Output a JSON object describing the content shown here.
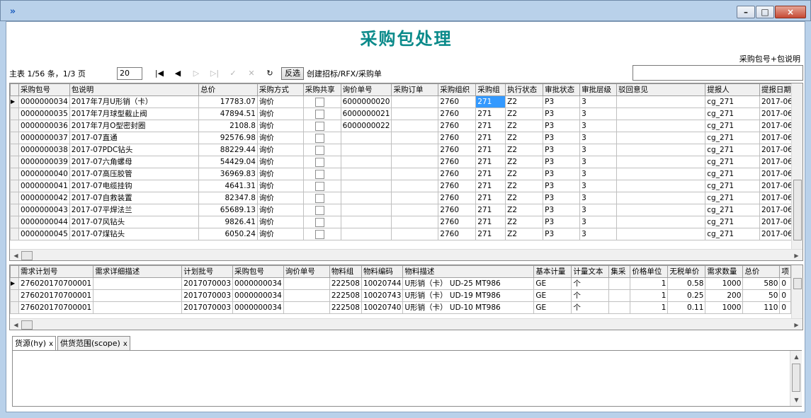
{
  "window": {
    "min_icon": "minimize-icon",
    "max_icon": "maximize-icon",
    "close_icon": "close-icon",
    "app_icon": "double-chevron-icon"
  },
  "page_title": "采购包处理",
  "search": {
    "label": "采购包号+包说明",
    "value": ""
  },
  "toolbar": {
    "pager_text": "主表 1/56 条，1/3 页",
    "page_size": "20",
    "icons": [
      "first-page-icon",
      "prev-page-icon",
      "next-page-icon",
      "last-page-icon",
      "check-icon",
      "cancel-icon",
      "refresh-icon"
    ],
    "invert_label": "反选",
    "create_label": "创建招标/RFX/采购单"
  },
  "main_grid": {
    "columns": [
      "采购包号",
      "包说明",
      "总价",
      "采购方式",
      "采购共享",
      "询价单号",
      "采购订单",
      "采购组织",
      "采购组",
      "执行状态",
      "审批状态",
      "审批层级",
      "驳回意见",
      "提报人",
      "提报日期"
    ],
    "rows": [
      [
        "0000000034",
        "2017年7月U形销（卡）",
        "17783.07",
        "询价",
        "",
        "6000000020",
        "",
        "2760",
        "271",
        "Z2",
        "P3",
        "3",
        "",
        "cg_271",
        "2017-06-0"
      ],
      [
        "0000000035",
        "2017年7月球型截止阀",
        "47894.51",
        "询价",
        "",
        "6000000021",
        "",
        "2760",
        "271",
        "Z2",
        "P3",
        "3",
        "",
        "cg_271",
        "2017-06-0"
      ],
      [
        "0000000036",
        "2017年7月O型密封圈",
        "2108.8",
        "询价",
        "",
        "6000000022",
        "",
        "2760",
        "271",
        "Z2",
        "P3",
        "3",
        "",
        "cg_271",
        "2017-06-0"
      ],
      [
        "0000000037",
        "2017-07直通",
        "92576.98",
        "询价",
        "",
        "",
        "",
        "2760",
        "271",
        "Z2",
        "P3",
        "3",
        "",
        "cg_271",
        "2017-06-0"
      ],
      [
        "0000000038",
        "2017-07PDC钻头",
        "88229.44",
        "询价",
        "",
        "",
        "",
        "2760",
        "271",
        "Z2",
        "P3",
        "3",
        "",
        "cg_271",
        "2017-06-0"
      ],
      [
        "0000000039",
        "2017-07六角螺母",
        "54429.04",
        "询价",
        "",
        "",
        "",
        "2760",
        "271",
        "Z2",
        "P3",
        "3",
        "",
        "cg_271",
        "2017-06-0"
      ],
      [
        "0000000040",
        "2017-07高压胶管",
        "36969.83",
        "询价",
        "",
        "",
        "",
        "2760",
        "271",
        "Z2",
        "P3",
        "3",
        "",
        "cg_271",
        "2017-06-0"
      ],
      [
        "0000000041",
        "2017-07电缆挂钩",
        "4641.31",
        "询价",
        "",
        "",
        "",
        "2760",
        "271",
        "Z2",
        "P3",
        "3",
        "",
        "cg_271",
        "2017-06-0"
      ],
      [
        "0000000042",
        "2017-07自救装置",
        "82347.8",
        "询价",
        "",
        "",
        "",
        "2760",
        "271",
        "Z2",
        "P3",
        "3",
        "",
        "cg_271",
        "2017-06-0"
      ],
      [
        "0000000043",
        "2017-07平焊法兰",
        "65689.13",
        "询价",
        "",
        "",
        "",
        "2760",
        "271",
        "Z2",
        "P3",
        "3",
        "",
        "cg_271",
        "2017-06-0"
      ],
      [
        "0000000044",
        "2017-07风钻头",
        "9826.41",
        "询价",
        "",
        "",
        "",
        "2760",
        "271",
        "Z2",
        "P3",
        "3",
        "",
        "cg_271",
        "2017-06-0"
      ],
      [
        "0000000045",
        "2017-07煤钻头",
        "6050.24",
        "询价",
        "",
        "",
        "",
        "2760",
        "271",
        "Z2",
        "P3",
        "3",
        "",
        "cg_271",
        "2017-06-0"
      ]
    ]
  },
  "detail_grid": {
    "columns": [
      "需求计划号",
      "需求详细描述",
      "计划批号",
      "采购包号",
      "询价单号",
      "物料组",
      "物料编码",
      "物料描述",
      "基本计量",
      "计量文本",
      "集采",
      "价格单位",
      "无税单价",
      "需求数量",
      "总价",
      "项"
    ],
    "rows": [
      [
        "276020170700001",
        "",
        "2017070003",
        "0000000034",
        "",
        "222508",
        "10020744",
        "U形销（卡） UD-25 MT986",
        "GE",
        "个",
        "",
        "1",
        "0.58",
        "1000",
        "580",
        "0"
      ],
      [
        "276020170700001",
        "",
        "2017070003",
        "0000000034",
        "",
        "222508",
        "10020743",
        "U形销（卡） UD-19 MT986",
        "GE",
        "个",
        "",
        "1",
        "0.25",
        "200",
        "50",
        "0"
      ],
      [
        "276020170700001",
        "",
        "2017070003",
        "0000000034",
        "",
        "222508",
        "10020740",
        "U形销（卡） UD-10 MT986",
        "GE",
        "个",
        "",
        "1",
        "0.11",
        "1000",
        "110",
        "0"
      ]
    ]
  },
  "tabs": [
    {
      "label": "货源(hy)",
      "close": "x"
    },
    {
      "label": "供货范围(scope)",
      "close": "x"
    }
  ]
}
